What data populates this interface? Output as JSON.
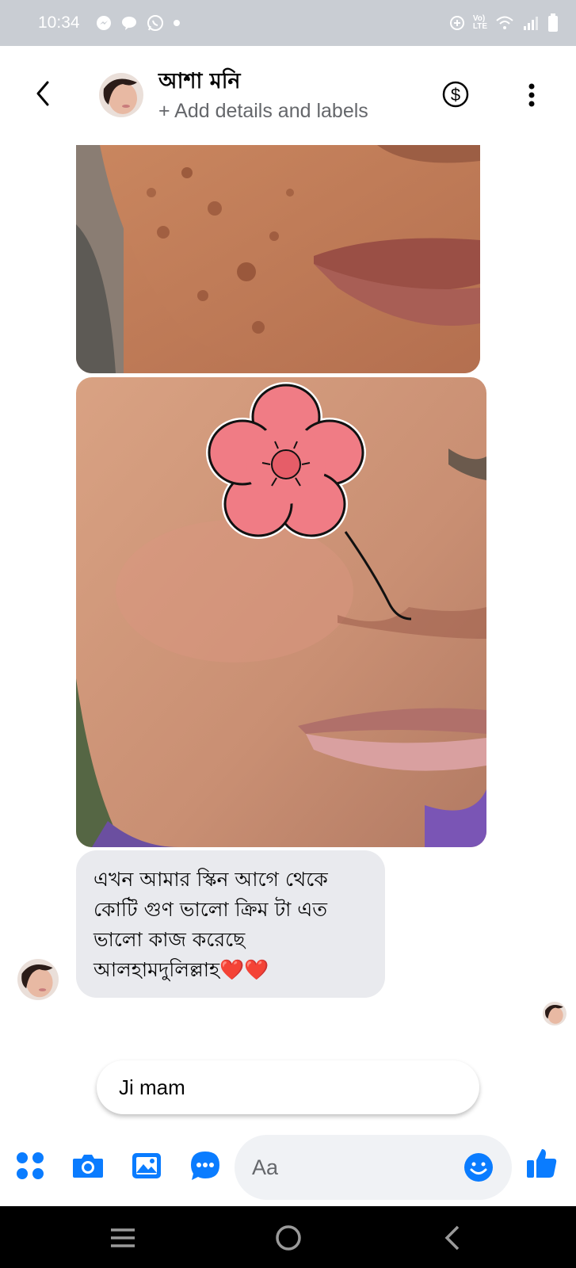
{
  "status_bar": {
    "time": "10:34",
    "icons": [
      "messenger-icon",
      "chat-bubble-icon",
      "whatsapp-icon",
      "dot-icon",
      "data-saver-icon",
      "volte-icon",
      "wifi-icon",
      "signal-icon",
      "battery-icon"
    ],
    "volte_label": "VoLTE"
  },
  "header": {
    "contact_name": "আশা মনি",
    "subtitle": "+ Add details and labels",
    "icons": [
      "back-icon",
      "avatar",
      "dollar-icon",
      "more-icon"
    ]
  },
  "messages": [
    {
      "type": "image",
      "from": "contact",
      "description_icon": "photo-face-before"
    },
    {
      "type": "image",
      "from": "contact",
      "description_icon": "photo-face-after"
    },
    {
      "type": "text",
      "from": "contact",
      "text": "এখন আমার স্কিন আগে থেকে\nকোটি গুণ ভালো ক্রিম টা এত\nভালো কাজ করেছে\nআলহামদুলিল্লাহ❤️❤️"
    }
  ],
  "suggested_reply": "Ji mam",
  "composer": {
    "placeholder": "Aa",
    "icons": [
      "apps-icon",
      "camera-icon",
      "gallery-icon",
      "chat-icon",
      "emoji-icon",
      "like-icon"
    ]
  },
  "nav_bar": {
    "icons": [
      "recents-icon",
      "home-icon",
      "back-nav-icon"
    ]
  },
  "colors": {
    "messenger_blue": "#0a7cff",
    "bubble_gray": "#e9eaee",
    "status_bar": "#c9cdd3"
  }
}
